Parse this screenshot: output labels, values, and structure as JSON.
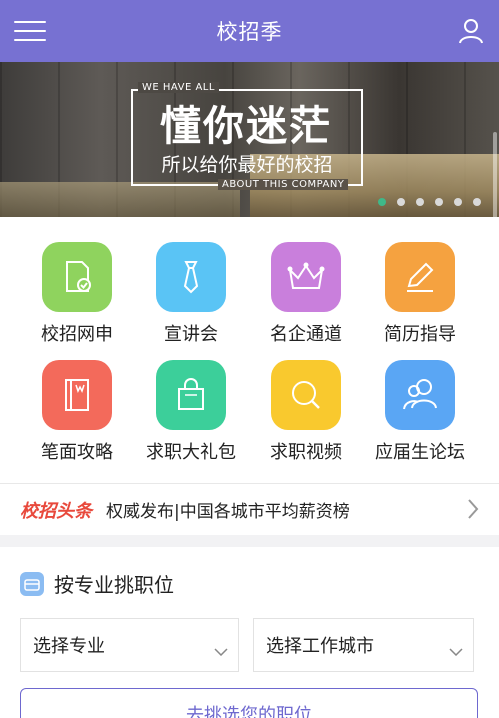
{
  "header": {
    "title": "校招季",
    "menu_icon": "hamburger-menu-icon",
    "user_icon": "user-icon",
    "bg_color": "#7771d2"
  },
  "banner": {
    "tagline_top": "WE HAVE ALL",
    "headline": "懂你迷茫",
    "subline": "所以给你最好的校招",
    "tagline_bottom": "ABOUT THIS COMPANY",
    "slide_count": 6,
    "active_slide": 1
  },
  "features": [
    {
      "label": "校招网申",
      "icon": "document-check-icon",
      "color": "#8fd35e"
    },
    {
      "label": "宣讲会",
      "icon": "tie-icon",
      "color": "#5ac4f5"
    },
    {
      "label": "名企通道",
      "icon": "crown-icon",
      "color": "#c97fdc"
    },
    {
      "label": "简历指导",
      "icon": "pencil-note-icon",
      "color": "#f5a240"
    },
    {
      "label": "笔面攻略",
      "icon": "book-icon",
      "color": "#f36a5b"
    },
    {
      "label": "求职大礼包",
      "icon": "shopping-bag-icon",
      "color": "#3ccf9a"
    },
    {
      "label": "求职视频",
      "icon": "search-icon",
      "color": "#f9c92e"
    },
    {
      "label": "应届生论坛",
      "icon": "people-icon",
      "color": "#5aa6f4"
    }
  ],
  "news": {
    "brand": "校招头条",
    "headline": "权威发布|中国各城市平均薪资榜"
  },
  "job_filter": {
    "title": "按专业挑职位",
    "major_select": "选择专业",
    "city_select": "选择工作城市",
    "submit": "去挑选您的职位"
  }
}
